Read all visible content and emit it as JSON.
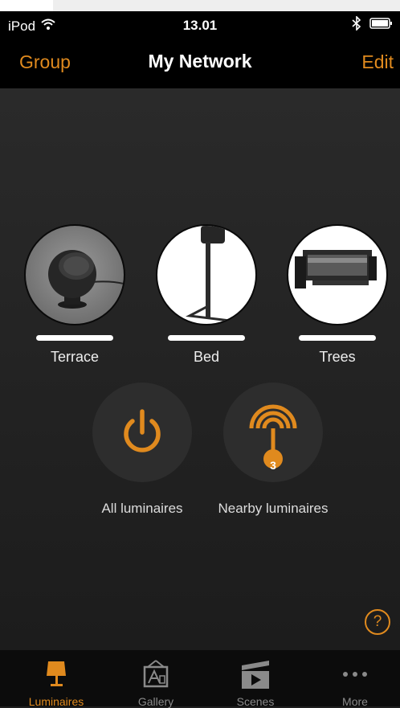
{
  "status_bar": {
    "carrier": "iPod",
    "time": "13.01"
  },
  "nav": {
    "left_button": "Group",
    "title": "My Network",
    "right_button": "Edit"
  },
  "luminaires": [
    {
      "label": "Terrace",
      "icon": "spot-lamp-icon"
    },
    {
      "label": "Bed",
      "icon": "spike-lamp-icon"
    },
    {
      "label": "Trees",
      "icon": "flood-light-icon"
    }
  ],
  "actions": {
    "all": {
      "label": "All luminaires",
      "icon": "power-icon"
    },
    "nearby": {
      "label": "Nearby luminaires",
      "icon": "signal-icon",
      "badge": "3"
    }
  },
  "help": {
    "glyph": "?"
  },
  "tabs": [
    {
      "label": "Luminaires",
      "icon": "lamp-icon",
      "active": true
    },
    {
      "label": "Gallery",
      "icon": "gallery-icon",
      "active": false
    },
    {
      "label": "Scenes",
      "icon": "clapper-icon",
      "active": false
    },
    {
      "label": "More",
      "icon": "more-icon",
      "active": false
    }
  ],
  "colors": {
    "accent": "#e08a1e",
    "background": "#1f1f1f",
    "bar": "#000000"
  }
}
